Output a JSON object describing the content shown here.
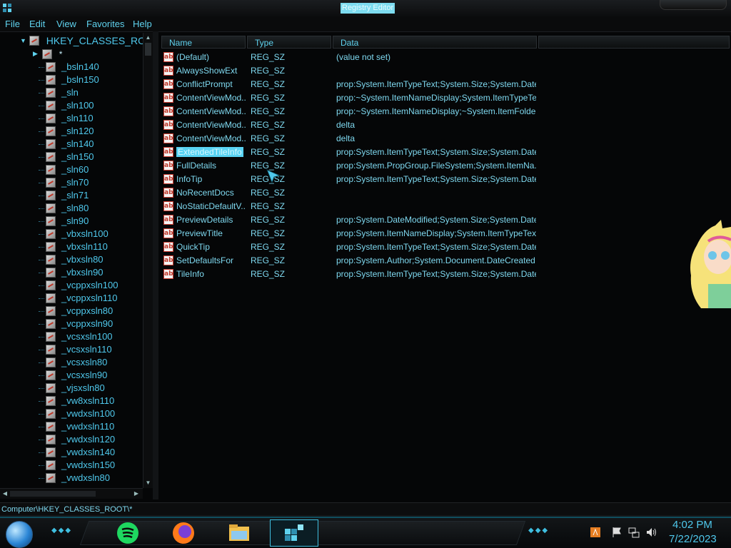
{
  "window": {
    "title": "Registry Editor"
  },
  "menu": [
    "File",
    "Edit",
    "View",
    "Favorites",
    "Help"
  ],
  "tree": {
    "root": "HKEY_CLASSES_ROOT",
    "first_child": "*",
    "items": [
      "_bsln140",
      "_bsln150",
      "_sln",
      "_sln100",
      "_sln110",
      "_sln120",
      "_sln140",
      "_sln150",
      "_sln60",
      "_sln70",
      "_sln71",
      "_sln80",
      "_sln90",
      "_vbxsln100",
      "_vbxsln110",
      "_vbxsln80",
      "_vbxsln90",
      "_vcppxsln100",
      "_vcppxsln110",
      "_vcppxsln80",
      "_vcppxsln90",
      "_vcsxsln100",
      "_vcsxsln110",
      "_vcsxsln80",
      "_vcsxsln90",
      "_vjsxsln80",
      "_vw8xsln110",
      "_vwdxsln100",
      "_vwdxsln110",
      "_vwdxsln120",
      "_vwdxsln140",
      "_vwdxsln150",
      "_vwdxsln80"
    ]
  },
  "list": {
    "columns": [
      "Name",
      "Type",
      "Data"
    ],
    "rows": [
      {
        "name": "(Default)",
        "type": "REG_SZ",
        "data": "(value not set)"
      },
      {
        "name": "AlwaysShowExt",
        "type": "REG_SZ",
        "data": ""
      },
      {
        "name": "ConflictPrompt",
        "type": "REG_SZ",
        "data": "prop:System.ItemTypeText;System.Size;System.Date..."
      },
      {
        "name": "ContentViewMod...",
        "type": "REG_SZ",
        "data": "prop:~System.ItemNameDisplay;System.ItemTypeTex..."
      },
      {
        "name": "ContentViewMod...",
        "type": "REG_SZ",
        "data": "prop:~System.ItemNameDisplay;~System.ItemFolde..."
      },
      {
        "name": "ContentViewMod...",
        "type": "REG_SZ",
        "data": "delta"
      },
      {
        "name": "ContentViewMod...",
        "type": "REG_SZ",
        "data": "delta"
      },
      {
        "name": "ExtendedTileInfo",
        "type": "REG_SZ",
        "data": "prop:System.ItemTypeText;System.Size;System.Date...",
        "selected": true
      },
      {
        "name": "FullDetails",
        "type": "REG_SZ",
        "data": "prop:System.PropGroup.FileSystem;System.ItemNa..."
      },
      {
        "name": "InfoTip",
        "type": "REG_SZ",
        "data": "prop:System.ItemTypeText;System.Size;System.Date..."
      },
      {
        "name": "NoRecentDocs",
        "type": "REG_SZ",
        "data": ""
      },
      {
        "name": "NoStaticDefaultV...",
        "type": "REG_SZ",
        "data": ""
      },
      {
        "name": "PreviewDetails",
        "type": "REG_SZ",
        "data": "prop:System.DateModified;System.Size;System.Date..."
      },
      {
        "name": "PreviewTitle",
        "type": "REG_SZ",
        "data": "prop:System.ItemNameDisplay;System.ItemTypeText"
      },
      {
        "name": "QuickTip",
        "type": "REG_SZ",
        "data": "prop:System.ItemTypeText;System.Size;System.Date..."
      },
      {
        "name": "SetDefaultsFor",
        "type": "REG_SZ",
        "data": "prop:System.Author;System.Document.DateCreated"
      },
      {
        "name": "TileInfo",
        "type": "REG_SZ",
        "data": "prop:System.ItemTypeText;System.Size;System.Date..."
      }
    ],
    "value_icon": "ab"
  },
  "status": {
    "path": "Computer\\HKEY_CLASSES_ROOT\\*"
  },
  "taskbar": {
    "apps": [
      "spotify-icon",
      "firefox-icon",
      "file-explorer-icon",
      "registry-editor-icon"
    ],
    "clock_time": "4:02 PM",
    "clock_date": "7/22/2023"
  },
  "colors": {
    "accent": "#59d3f3",
    "text": "#7fd9f0",
    "background": "#050607"
  }
}
